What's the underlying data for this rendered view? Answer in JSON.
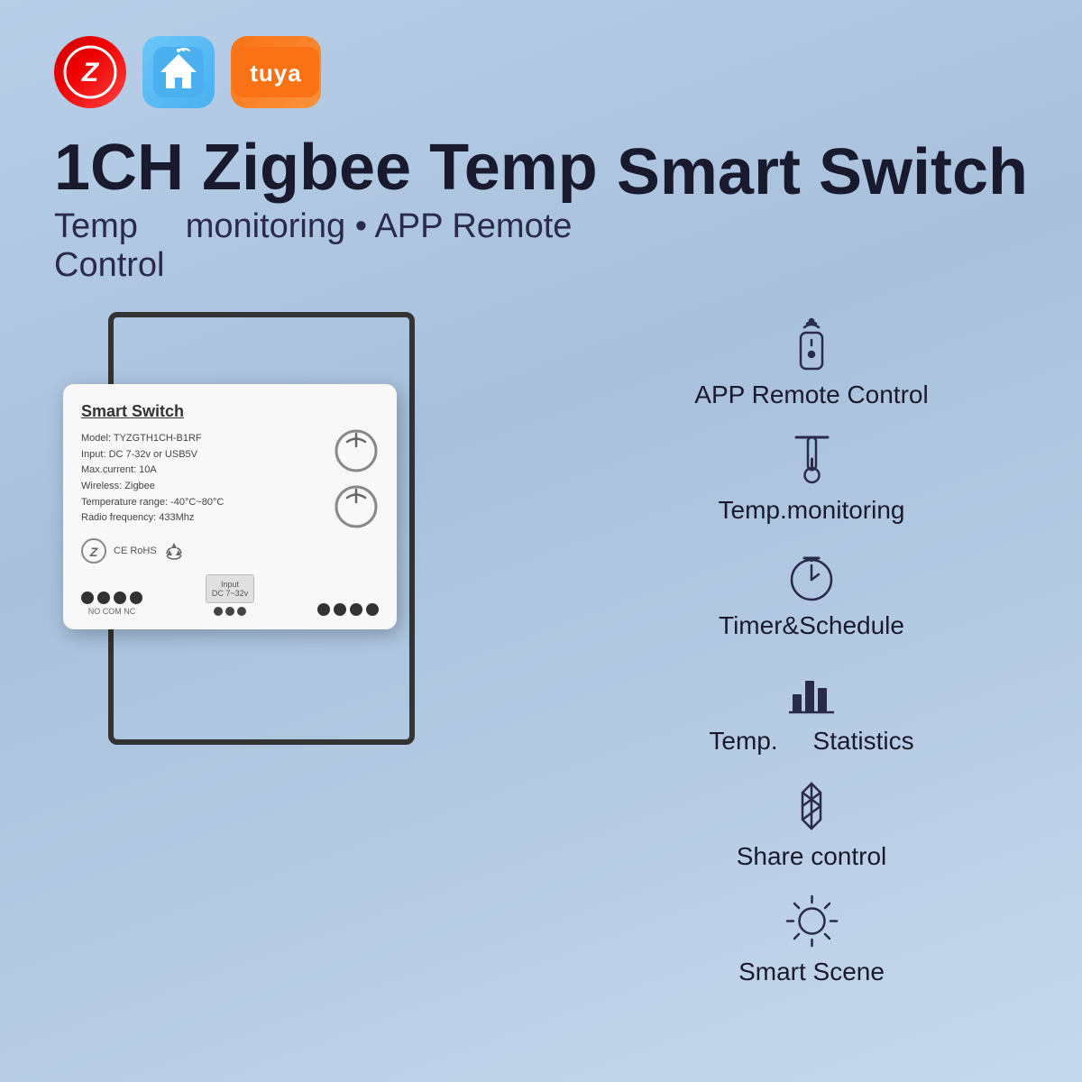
{
  "logos": {
    "zigbee_label": "Z",
    "smarthome_label": "🏠",
    "tuya_label": "tuya"
  },
  "header": {
    "main_title": "1CH Zigbee Temp",
    "subtitle": "Temp   monitoring • APP Remote Control",
    "smart_switch_title": "Smart Switch"
  },
  "device": {
    "label": "Smart Switch",
    "specs": [
      "Model: TYZGTH1CH-B1RF",
      "Input: DC 7-32v or USB5V",
      "Max.current: 10A",
      "Wireless: Zigbee",
      "Temperature range: -40°C~80°C",
      "Radio frequency: 433Mhz"
    ],
    "input_label": "Input\nDC 7~32v",
    "connector_labels": [
      "NO",
      "COM",
      "NC"
    ]
  },
  "features": [
    {
      "id": "app-remote",
      "icon": "remote-icon",
      "label": "APP Remote Control"
    },
    {
      "id": "temp-monitoring",
      "icon": "thermometer-icon",
      "label": "Temp.monitoring"
    },
    {
      "id": "timer-schedule",
      "icon": "timer-icon",
      "label": "Timer&Schedule"
    },
    {
      "id": "temp-statistics",
      "icon": "chart-icon",
      "label": "Temp.   Statistics"
    },
    {
      "id": "share-control",
      "icon": "bluetooth-icon",
      "label": "Share control"
    },
    {
      "id": "smart-scene",
      "icon": "sun-icon",
      "label": "Smart Scene"
    }
  ]
}
